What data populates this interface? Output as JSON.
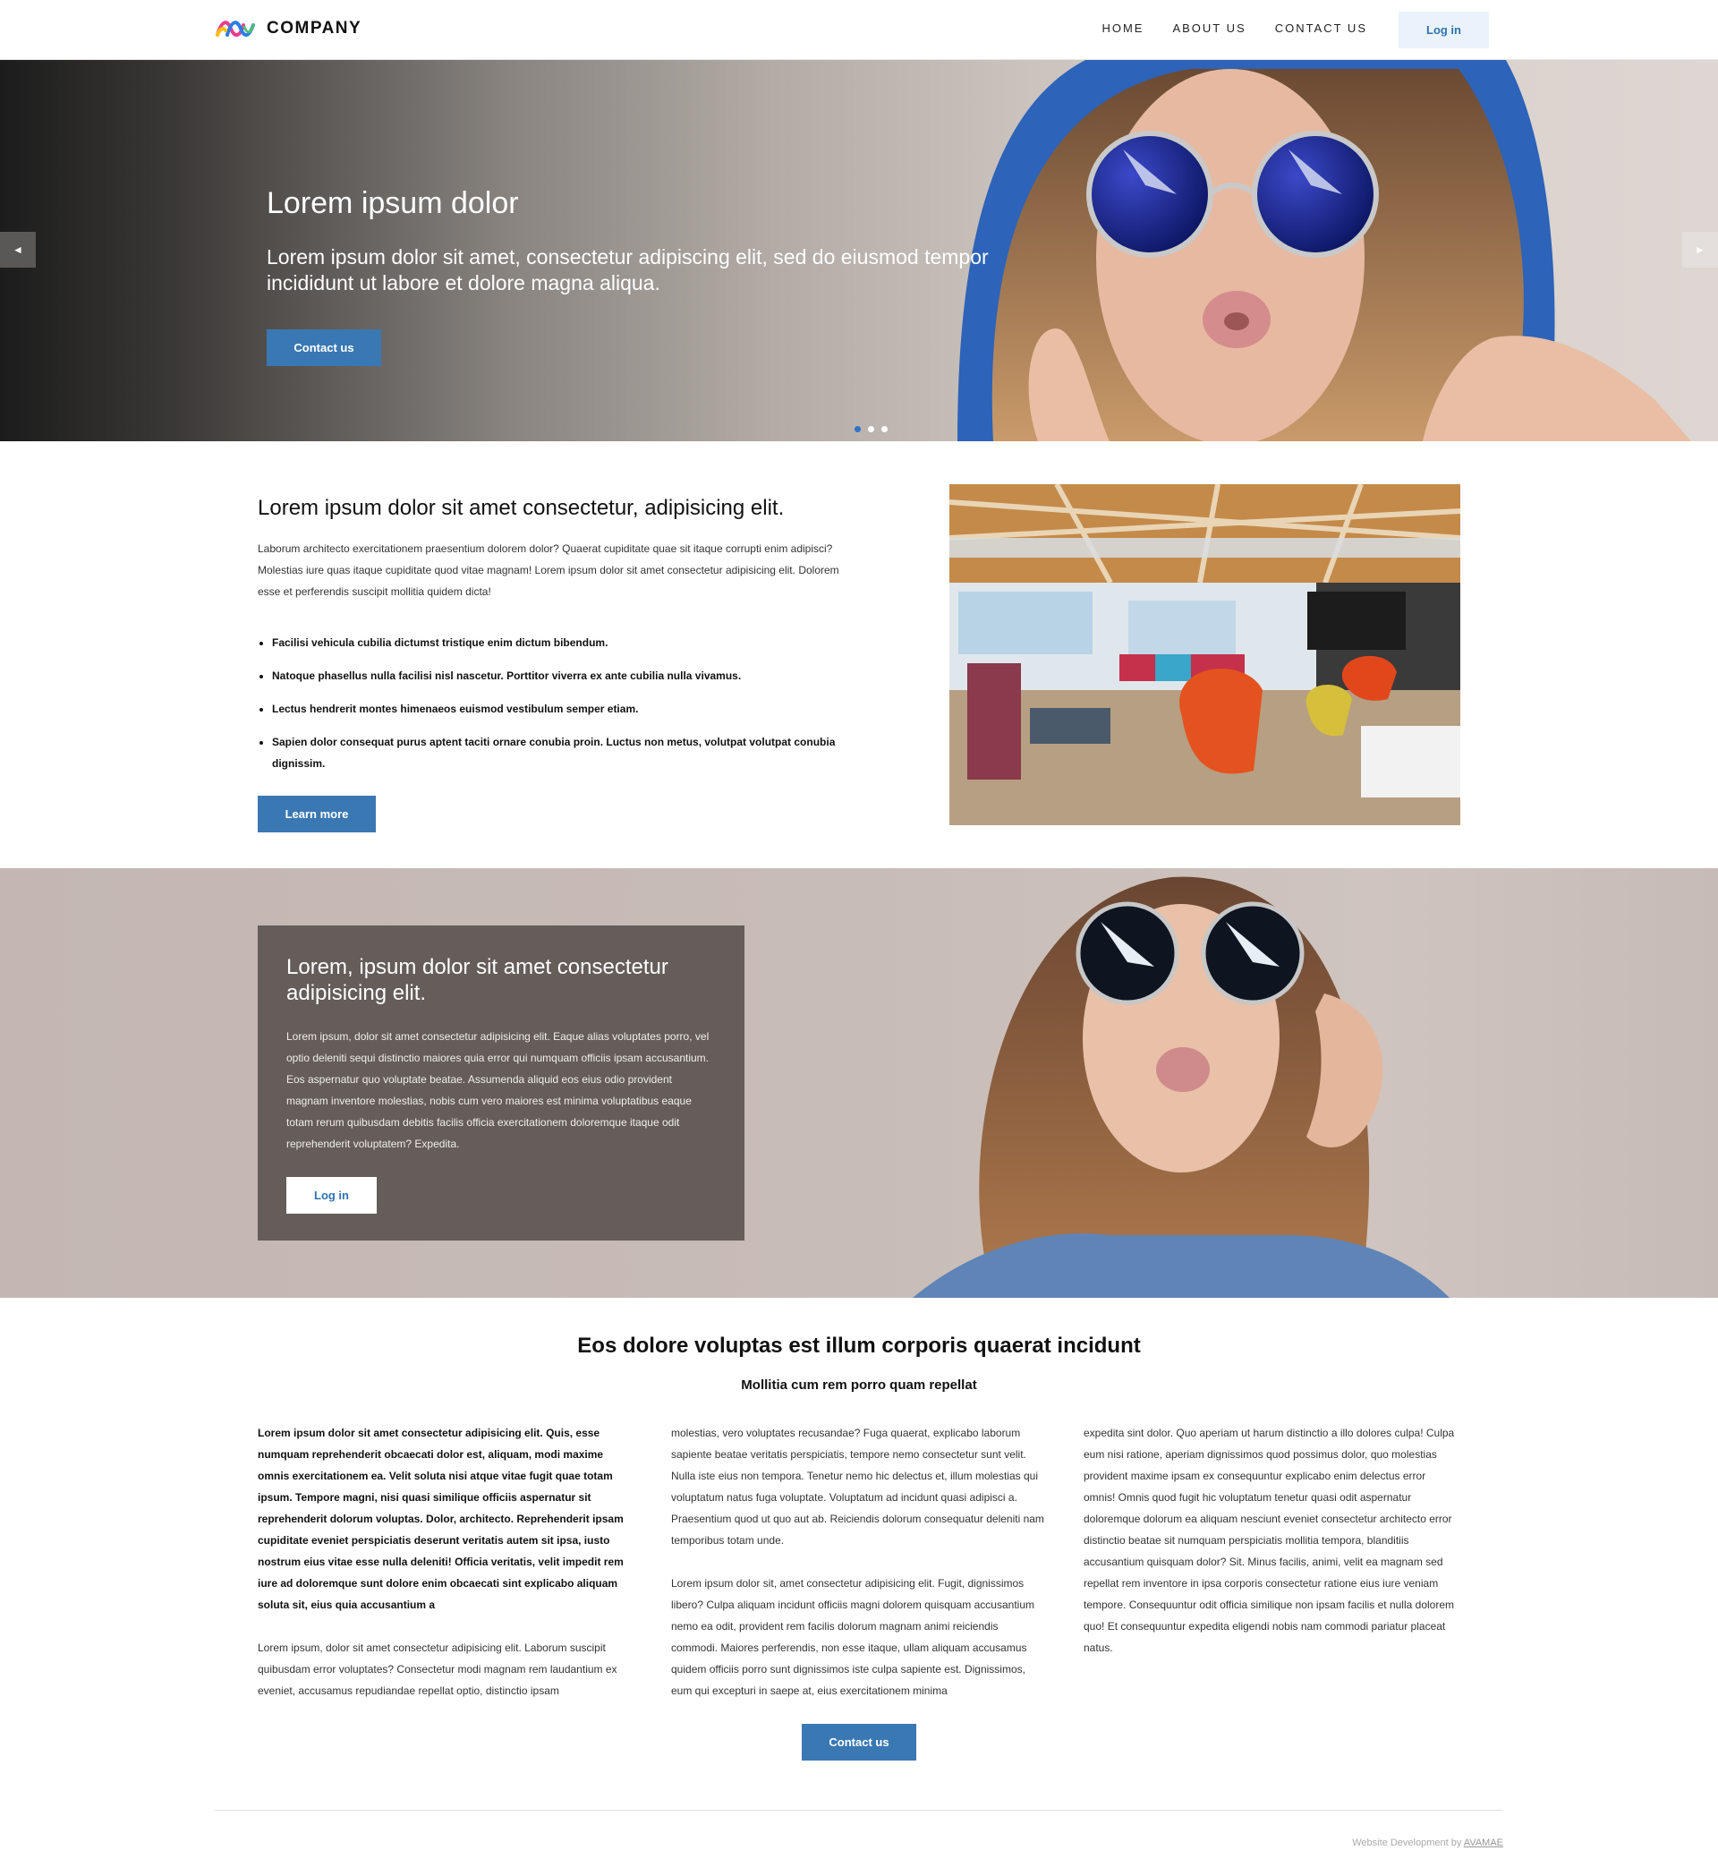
{
  "header": {
    "logo_text": "COMPANY",
    "nav": [
      "HOME",
      "ABOUT US",
      "CONTACT US"
    ],
    "login_label": "Log in"
  },
  "hero": {
    "title": "Lorem ipsum dolor",
    "subtitle": "Lorem ipsum dolor sit amet, consectetur adipiscing elit, sed do eiusmod tempor incididunt ut labore et dolore magna aliqua.",
    "button": "Contact us",
    "prev_arrow": "◄",
    "next_arrow": "►",
    "slides": 3,
    "active_slide": 1
  },
  "intro": {
    "title": "Lorem ipsum dolor sit amet consectetur, adipisicing elit.",
    "paragraph": "Laborum architecto exercitationem praesentium dolorem dolor? Quaerat cupiditate quae sit itaque corrupti enim adipisci? Molestias iure quas itaque cupiditate quod vitae magnam! Lorem ipsum dolor sit amet consectetur adipisicing elit. Dolorem esse et perferendis suscipit mollitia quidem dicta!",
    "list": [
      "Facilisi vehicula cubilia dictumst tristique enim dictum bibendum.",
      "Natoque phasellus nulla facilisi nisl nascetur. Porttitor viverra ex ante cubilia nulla vivamus.",
      "Lectus hendrerit montes himenaeos euismod vestibulum semper etiam.",
      "Sapien dolor consequat purus aptent taciti ornare conubia proin. Luctus non metus, volutpat volutpat conubia dignissim."
    ],
    "button": "Learn more"
  },
  "feature": {
    "title": "Lorem, ipsum dolor sit amet consectetur adipisicing elit.",
    "paragraph": "Lorem ipsum, dolor sit amet consectetur adipisicing elit. Eaque alias voluptates porro, vel optio deleniti sequi distinctio maiores quia error qui numquam officiis ipsam accusantium. Eos aspernatur quo voluptate beatae. Assumenda aliquid eos eius odio provident magnam inventore molestias, nobis cum vero maiores est minima voluptatibus eaque totam rerum quibusdam debitis facilis officia exercitationem doloremque itaque odit reprehenderit voluptatem? Expedita.",
    "button": "Log in"
  },
  "columns": {
    "title": "Eos dolore voluptas est illum corporis quaerat incidunt",
    "subtitle": "Mollitia cum rem porro quam repellat",
    "col1_bold": "Lorem ipsum dolor sit amet consectetur adipisicing elit. Quis, esse numquam reprehenderit obcaecati dolor est, aliquam, modi maxime omnis exercitationem ea. Velit soluta nisi atque vitae fugit quae totam ipsum. Tempore magni, nisi quasi similique officiis aspernatur sit reprehenderit dolorum voluptas. Dolor, architecto. Reprehenderit ipsam cupiditate eveniet perspiciatis deserunt veritatis autem sit ipsa, iusto nostrum eius vitae esse nulla deleniti! Officia veritatis, velit impedit rem iure ad doloremque sunt dolore enim obcaecati sint explicabo aliquam soluta sit, eius quia accusantium a",
    "col1_text": "Lorem ipsum, dolor sit amet consectetur adipisicing elit. Laborum suscipit quibusdam error voluptates? Consectetur modi magnam rem laudantium ex eveniet, accusamus repudiandae repellat optio, distinctio ipsam",
    "col2_text1": "molestias, vero voluptates recusandae? Fuga quaerat, explicabo laborum sapiente beatae veritatis perspiciatis, tempore nemo consectetur sunt velit. Nulla iste eius non tempora. Tenetur nemo hic delectus et, illum molestias qui voluptatum natus fuga voluptate. Voluptatum ad incidunt quasi adipisci a. Praesentium quod ut quo aut ab. Reiciendis dolorum consequatur deleniti nam temporibus totam unde.",
    "col2_text2": "Lorem ipsum dolor sit, amet consectetur adipisicing elit. Fugit, dignissimos libero? Culpa aliquam incidunt officiis magni dolorem quisquam accusantium nemo ea odit, provident rem facilis dolorum magnam animi reiciendis commodi. Maiores perferendis, non esse itaque, ullam aliquam accusamus quidem officiis porro sunt dignissimos iste culpa sapiente est. Dignissimos, eum qui excepturi in saepe at, eius exercitationem minima",
    "col3_text": "expedita sint dolor. Quo aperiam ut harum distinctio a illo dolores culpa! Culpa eum nisi ratione, aperiam dignissimos quod possimus dolor, quo molestias provident maxime ipsam ex consequuntur explicabo enim delectus error omnis! Omnis quod fugit hic voluptatum tenetur quasi odit aspernatur doloremque dolorum ea aliquam nesciunt eveniet consectetur architecto error distinctio beatae sit numquam perspiciatis mollitia tempora, blanditiis accusantium quisquam dolor? Sit. Minus facilis, animi, velit ea magnam sed repellat rem inventore in ipsa corporis consectetur ratione eius iure veniam tempore. Consequuntur odit officia similique non ipsam facilis et nulla dolorem quo! Et consequuntur expedita eligendi nobis nam commodi pariatur placeat natus.",
    "button": "Contact us"
  },
  "footer": {
    "credit": "Website Development by ",
    "credit_link": "AVAMAE"
  },
  "colors": {
    "accent": "#3a78b3",
    "login_bg": "#eaf3fb",
    "feature_box": "#645d59"
  }
}
